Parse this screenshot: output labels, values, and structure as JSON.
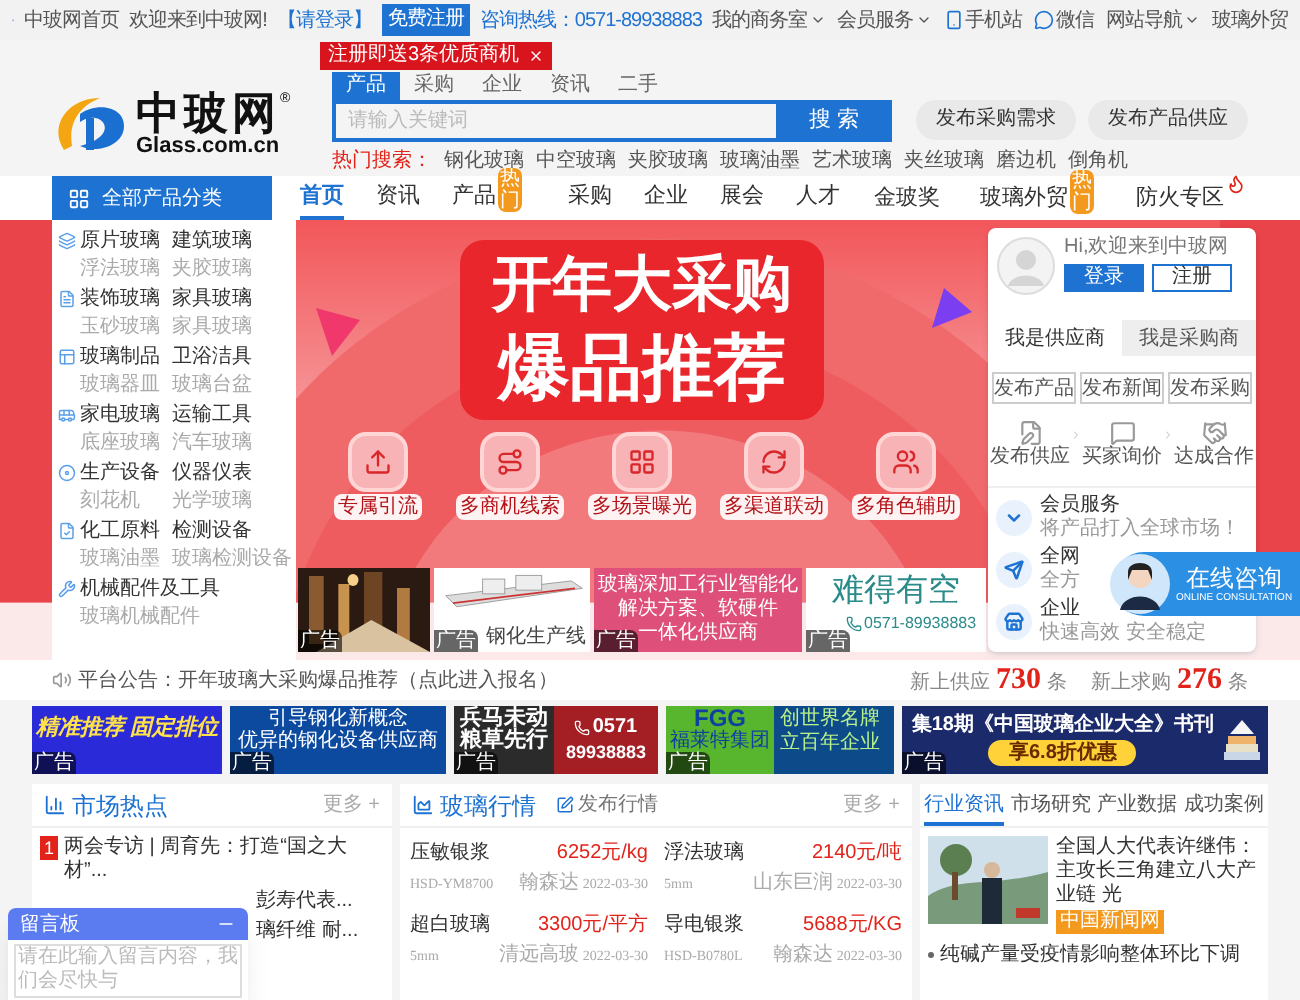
{
  "top_bar": {
    "home": "中玻网首页",
    "welcome": "欢迎来到中玻网!",
    "login": "【请登录】",
    "register": "免费注册",
    "hotline": "咨询热线：0571-89938883",
    "menus": [
      {
        "label": "我的商务室",
        "kind": "dropdown"
      },
      {
        "label": "会员服务",
        "kind": "dropdown"
      },
      {
        "label": "手机站",
        "kind": "phone"
      },
      {
        "label": "微信",
        "kind": "wechat"
      },
      {
        "label": "网站导航",
        "kind": "dropdown"
      },
      {
        "label": "玻璃外贸",
        "kind": "plain"
      }
    ]
  },
  "register_tip": "注册即送3条优质商机",
  "logo": {
    "name": "中玻网",
    "mark": "®",
    "domain": "Glass.com.cn"
  },
  "search": {
    "tabs": [
      {
        "label": "产品",
        "selected": true
      },
      {
        "label": "采购",
        "selected": false
      },
      {
        "label": "企业",
        "selected": false
      },
      {
        "label": "资讯",
        "selected": false
      },
      {
        "label": "二手",
        "selected": false
      }
    ],
    "placeholder": "请输入关键词",
    "button": "搜 索",
    "hot_label": "热门搜索：",
    "hot": [
      "钢化玻璃",
      "中空玻璃",
      "夹胶玻璃",
      "玻璃油墨",
      "艺术玻璃",
      "夹丝玻璃",
      "磨边机",
      "倒角机"
    ]
  },
  "header_buttons": [
    "发布采购需求",
    "发布产品供应"
  ],
  "nav": {
    "category_title": "全部产品分类",
    "items": [
      {
        "label": "首页",
        "selected": true
      },
      {
        "label": "资讯",
        "selected": false
      },
      {
        "label": "产品",
        "selected": false,
        "badge": "热门"
      },
      {
        "label": "采购",
        "selected": false
      },
      {
        "label": "企业",
        "selected": false
      },
      {
        "label": "展会",
        "selected": false
      },
      {
        "label": "人才",
        "selected": false
      }
    ],
    "right_items": [
      {
        "label": "金玻奖",
        "kind": "plain"
      },
      {
        "label": "玻璃外贸",
        "kind": "badge",
        "badge": "热门"
      },
      {
        "label": "防火专区",
        "kind": "flame"
      }
    ]
  },
  "categories": [
    [
      {
        "name": "原片玻璃",
        "sub": "浮法玻璃"
      },
      {
        "name": "建筑玻璃",
        "sub": "夹胶玻璃"
      }
    ],
    [
      {
        "name": "装饰玻璃",
        "sub": "玉砂玻璃"
      },
      {
        "name": "家具玻璃",
        "sub": "家具玻璃"
      }
    ],
    [
      {
        "name": "玻璃制品",
        "sub": "玻璃器皿"
      },
      {
        "name": "卫浴洁具",
        "sub": "玻璃台盆"
      }
    ],
    [
      {
        "name": "家电玻璃",
        "sub": "底座玻璃"
      },
      {
        "name": "运输工具",
        "sub": "汽车玻璃"
      }
    ],
    [
      {
        "name": "生产设备",
        "sub": "刻花机"
      },
      {
        "name": "仪器仪表",
        "sub": "光学玻璃"
      }
    ],
    [
      {
        "name": "化工原料",
        "sub": "玻璃油墨"
      },
      {
        "name": "检测设备",
        "sub": "玻璃检测设备"
      }
    ],
    [
      {
        "name": "机械配件及工具",
        "sub": "玻璃机械配件"
      }
    ]
  ],
  "banner": {
    "headline": [
      "开年大采购",
      "爆品推荐"
    ],
    "features": [
      "专属引流",
      "多商机线索",
      "多场景曝光",
      "多渠道联动",
      "多角色辅助"
    ],
    "ads": [
      {
        "tag": "广告"
      },
      {
        "kind": "machine",
        "caption": "钢化生产线",
        "tag": "广告"
      },
      {
        "kind": "text",
        "lines": [
          "玻璃深加工行业智能化",
          "解决方案、软硬件",
          "一体化供应商"
        ],
        "tag": "广告"
      },
      {
        "kind": "phone",
        "title": "难得有空",
        "phone": "0571-89938883",
        "tag": "广告"
      }
    ]
  },
  "login_card": {
    "greeting": "Hi,欢迎来到中玻网",
    "login": "登录",
    "register": "注册",
    "roles": [
      {
        "label": "我是供应商",
        "selected": true
      },
      {
        "label": "我是采购商",
        "selected": false
      }
    ],
    "actions": [
      "发布产品",
      "发布新闻",
      "发布采购"
    ],
    "steps": [
      "发布供应",
      "买家询价",
      "达成合作"
    ],
    "services": [
      {
        "title": "会员服务",
        "desc": "将产品打入全球市场！"
      },
      {
        "title": "全网",
        "desc": "全方"
      },
      {
        "title": "企业",
        "desc": "快速高效 安全稳定"
      }
    ]
  },
  "consult": {
    "title": "在线咨询",
    "subtitle": "ONLINE CONSULTATION"
  },
  "notice": {
    "text": "平台公告：开年玻璃大采购爆品推荐（点此进入报名）",
    "stats": [
      {
        "label": "新上供应",
        "value": "730",
        "unit": "条"
      },
      {
        "label": "新上求购",
        "value": "276",
        "unit": "条"
      }
    ]
  },
  "ad_strip": [
    {
      "kind": "blue",
      "lines": [
        "精准推荐 固定排位"
      ],
      "tag": "广告"
    },
    {
      "kind": "navy",
      "lines": [
        "引导钢化新概念",
        "优异的钢化设备供应商"
      ],
      "tag": "广告"
    },
    {
      "kind": "split",
      "lines": [
        "兵马未动",
        "粮草先行"
      ],
      "phone": [
        "0571",
        "89938883"
      ],
      "tag": "广告"
    },
    {
      "kind": "green",
      "logo": "FGG",
      "brand": "福莱特集团",
      "lines": [
        "创世界名牌",
        "立百年企业"
      ],
      "tag": "广告"
    },
    {
      "kind": "book",
      "lines": [
        "集18期《中国玻璃企业大全》书刊"
      ],
      "cta": "享6.8折优惠",
      "tag": "广告"
    }
  ],
  "market_hot": {
    "title": "市场热点",
    "more": "更多 +",
    "items": [
      {
        "rank": "1",
        "text": "两会专访 | 周育先：打造“国之大材”..."
      },
      {
        "text": "彭寿代表..."
      },
      {
        "text": "璃纤维 耐..."
      }
    ]
  },
  "prices": {
    "title": "玻璃行情",
    "publish": "发布行情",
    "more": "更多 +",
    "rows": [
      {
        "name": "压敏银浆",
        "price": "6252元/kg",
        "code": "HSD-YM8700",
        "source": "翰森达",
        "date": "2022-03-30"
      },
      {
        "name": "浮法玻璃",
        "price": "2140元/吨",
        "code": "5mm",
        "source": "山东巨润",
        "date": "2022-03-30"
      },
      {
        "name": "超白玻璃",
        "price": "3300元/平方",
        "code": "5mm",
        "source": "清远高玻",
        "date": "2022-03-30"
      },
      {
        "name": "导电银浆",
        "price": "5688元/KG",
        "code": "HSD-B0780L",
        "source": "翰森达",
        "date": "2022-03-30"
      }
    ]
  },
  "news": {
    "tabs": [
      {
        "label": "行业资讯",
        "selected": true
      },
      {
        "label": "市场研究",
        "selected": false
      },
      {
        "label": "产业数据",
        "selected": false
      },
      {
        "label": "成功案例",
        "selected": false
      }
    ],
    "featured": {
      "title": "全国人大代表许继伟：主攻长三角建立八大产业链 光",
      "source": "中国新闻网"
    },
    "items": [
      "纯碱产量受疫情影响整体环比下调"
    ]
  },
  "message_board": {
    "title": "留言板",
    "placeholder": "请在此输入留言内容，我们会尽快与"
  }
}
